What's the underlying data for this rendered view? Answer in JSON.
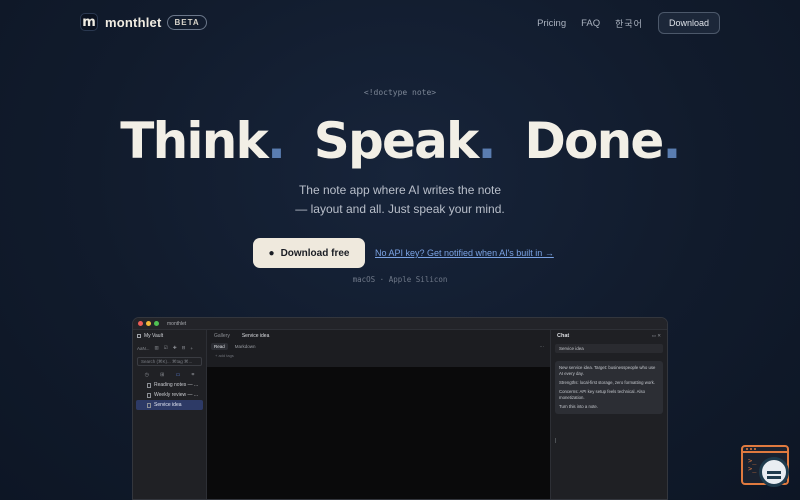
{
  "nav": {
    "brand_glyph": "m",
    "brand": "monthlet",
    "badge": "BETA",
    "links": [
      "Pricing",
      "FAQ",
      "한국어"
    ],
    "download": "Download"
  },
  "hero": {
    "doctype": "<!doctype note>",
    "headline": [
      "Think",
      "Speak",
      "Done"
    ],
    "headline_punct": ".",
    "subtitle_line1": "The note app where AI writes the note",
    "subtitle_line2": "— layout and all. Just speak your mind.",
    "primary_cta": "Download free",
    "secondary_cta": "No API key? Get notified when AI's built in →",
    "platform": "macOS · Apple Silicon"
  },
  "app": {
    "window_title": "monthlet",
    "vault": "My Vault",
    "toolbar_items": [
      "AaN...",
      "▥",
      "☑",
      "✚",
      "⊟",
      "+"
    ],
    "search_placeholder": "Search (⌘K)... ⌘tag ⌘...",
    "files": [
      "Reading notes — ...",
      "Weekly review — ...",
      "Service idea"
    ],
    "tabs": [
      "Gallery",
      "Service idea"
    ],
    "modes": [
      "Read",
      "Markdown"
    ],
    "add_tags": "+ add tags",
    "chat_title": "Chat",
    "chat_file": "Service idea",
    "chat_message": [
      "New service idea. Target: businesspeople who use AI every day.",
      "Strengths: local-first storage, zero formatting work.",
      "Concerns: API key setup feels technical. Also monetization.",
      "Turn this into a note."
    ],
    "chat_caret": "|"
  },
  "colors": {
    "background": "#111b2c",
    "accent_dot": "#5a7db1",
    "primary_button": "#efe9dd",
    "link": "#7aa2e3"
  }
}
